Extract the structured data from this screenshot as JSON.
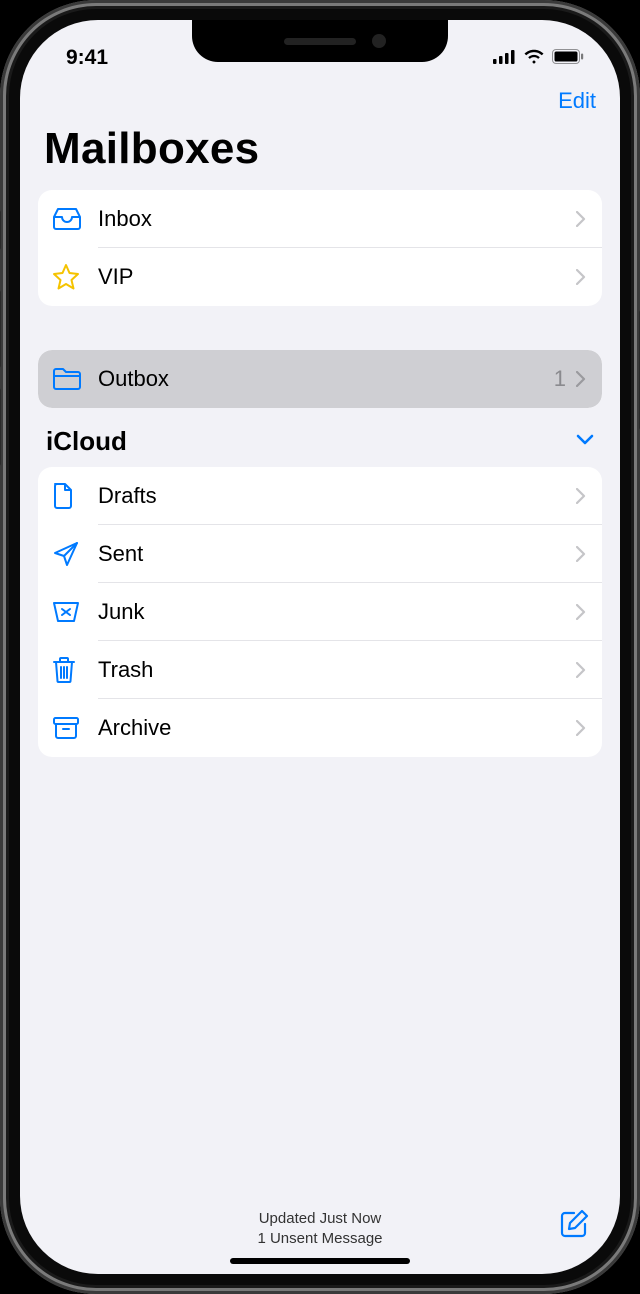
{
  "status_bar": {
    "time": "9:41"
  },
  "nav": {
    "edit_label": "Edit"
  },
  "title": "Mailboxes",
  "colors": {
    "accent": "#007aff",
    "star": "#f5c300",
    "bg": "#f2f2f7",
    "row_highlight": "#cfcfd3",
    "secondary_text": "#8a8a8e"
  },
  "top_mailboxes": [
    {
      "icon": "inbox-icon",
      "label": "Inbox",
      "count": ""
    },
    {
      "icon": "star-icon",
      "label": "VIP",
      "count": ""
    }
  ],
  "outbox": {
    "icon": "folder-icon",
    "label": "Outbox",
    "count": "1"
  },
  "account": {
    "name": "iCloud",
    "folders": [
      {
        "icon": "document-icon",
        "label": "Drafts"
      },
      {
        "icon": "paperplane-icon",
        "label": "Sent"
      },
      {
        "icon": "junk-icon",
        "label": "Junk"
      },
      {
        "icon": "trash-icon",
        "label": "Trash"
      },
      {
        "icon": "archive-icon",
        "label": "Archive"
      }
    ]
  },
  "footer": {
    "status_line1": "Updated Just Now",
    "status_line2": "1 Unsent Message"
  }
}
